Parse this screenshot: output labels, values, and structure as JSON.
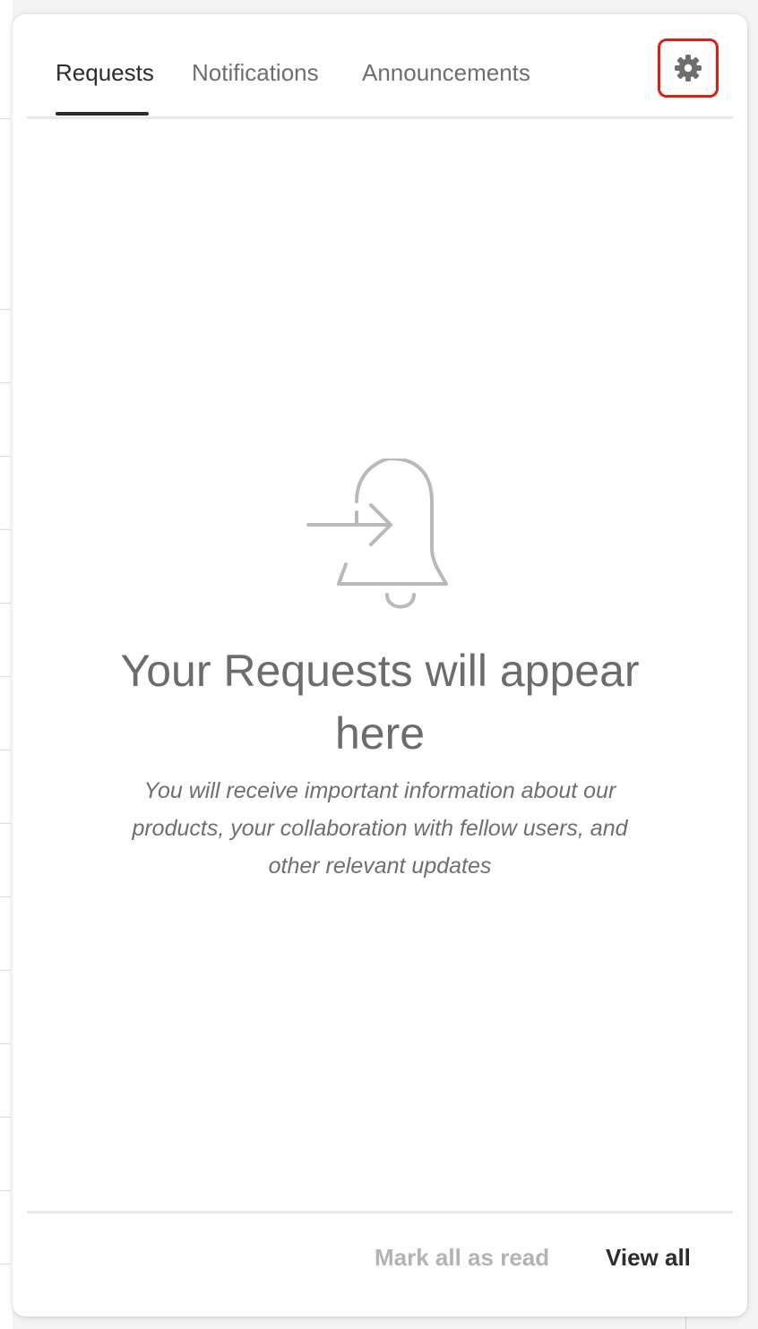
{
  "tabs": [
    {
      "label": "Requests",
      "active": true
    },
    {
      "label": "Notifications",
      "active": false
    },
    {
      "label": "Announcements",
      "active": false
    }
  ],
  "settings": {
    "icon": "gear-icon",
    "highlight_color": "#e11d0f"
  },
  "empty_state": {
    "icon": "bell-arrow-icon",
    "title": "Your Requests will appear here",
    "description": "You will receive important information about our products, your collaboration with fellow users, and other relevant updates"
  },
  "footer": {
    "mark_all_label": "Mark all as read",
    "view_all_label": "View all"
  },
  "colors": {
    "active_tab": "#2c2c2c",
    "inactive_tab": "#6e6e6e",
    "disabled_text": "#b3b3b3",
    "icon_gray": "#b9b9b9"
  }
}
